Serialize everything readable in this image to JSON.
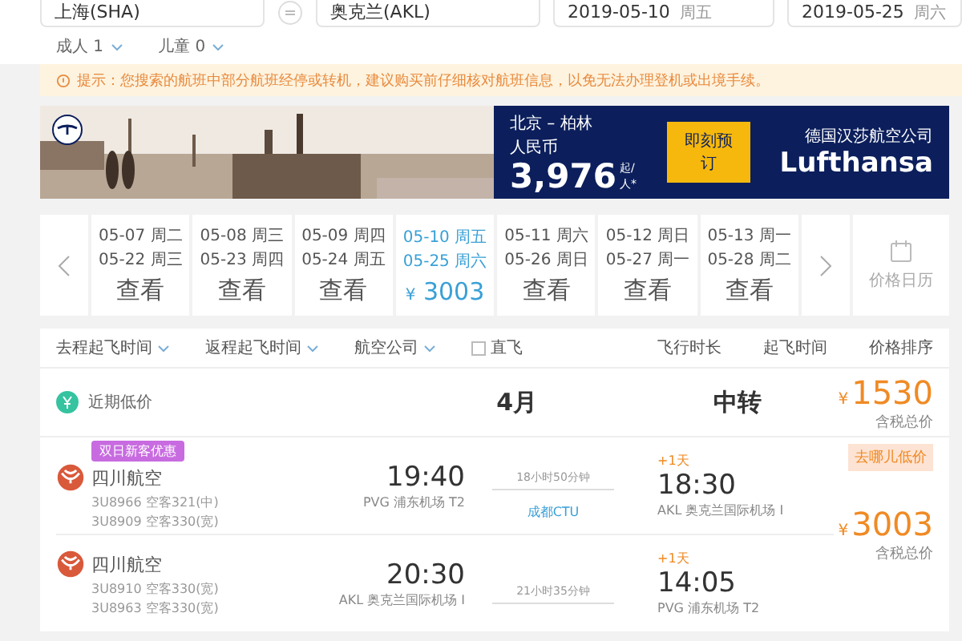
{
  "search": {
    "from": "上海(SHA)",
    "to": "奥克兰(AKL)",
    "depart_date": "2019-05-10",
    "depart_weekday": "周五",
    "return_date": "2019-05-25",
    "return_weekday": "周六"
  },
  "passengers": [
    {
      "label": "成人 1"
    },
    {
      "label": "儿童 0"
    }
  ],
  "notice": "提示：您搜索的航班中部分航班经停或转机，建议购买前仔细核对航班信息，以免无法办理登机或出境手续。",
  "banner": {
    "route": "北京 – 柏林",
    "currency": "人民币",
    "price": "3,976",
    "price_suffix": "起/人*",
    "button": "即刻预订",
    "airline_cn": "德国汉莎航空公司",
    "airline": "Lufthansa"
  },
  "dates": [
    {
      "out": "05-07 周二",
      "back": "05-22 周三",
      "price": "查看",
      "selected": false
    },
    {
      "out": "05-08 周三",
      "back": "05-23 周四",
      "price": "查看",
      "selected": false
    },
    {
      "out": "05-09 周四",
      "back": "05-24 周五",
      "price": "查看",
      "selected": false
    },
    {
      "out": "05-10 周五",
      "back": "05-25 周六",
      "price": "3003",
      "currency": "¥",
      "selected": true
    },
    {
      "out": "05-11 周六",
      "back": "05-26 周日",
      "price": "查看",
      "selected": false
    },
    {
      "out": "05-12 周日",
      "back": "05-27 周一",
      "price": "查看",
      "selected": false
    },
    {
      "out": "05-13 周一",
      "back": "05-28 周二",
      "price": "查看",
      "selected": false
    }
  ],
  "calendar_label": "价格日历",
  "filters": [
    {
      "label": "去程起飞时间"
    },
    {
      "label": "返程起飞时间"
    },
    {
      "label": "航空公司"
    }
  ],
  "direct_only": {
    "label": "直飞",
    "checked": false
  },
  "sorts": [
    {
      "label": "飞行时长"
    },
    {
      "label": "起飞时间"
    },
    {
      "label": "价格排序"
    }
  ],
  "low_price": {
    "label": "近期低价",
    "month": "4月",
    "type": "中转",
    "currency": "¥",
    "price": "1530",
    "note": "含税总价"
  },
  "flights": [
    {
      "tag": "双日新客优惠",
      "airline": "四川航空",
      "codes": [
        "3U8966 空客321(中)",
        "3U8909 空客330(宽)"
      ],
      "dep_time": "19:40",
      "dep_airport": "PVG 浦东机场 T2",
      "duration": "18小时50分钟",
      "stop": "成都CTU",
      "arr_day": "+1天",
      "arr_time": "18:30",
      "arr_airport": "AKL 奥克兰国际机场 I",
      "badge": "去哪儿低价"
    },
    {
      "airline": "四川航空",
      "codes": [
        "3U8910 空客330(宽)",
        "3U8963 空客330(宽)"
      ],
      "dep_time": "20:30",
      "dep_airport": "AKL 奥克兰国际机场 I",
      "duration": "21小时35分钟",
      "arr_day": "+1天",
      "arr_time": "14:05",
      "arr_airport": "PVG 浦东机场 T2"
    }
  ],
  "trip_price": {
    "currency": "¥",
    "price": "3003",
    "note": "含税总价"
  }
}
